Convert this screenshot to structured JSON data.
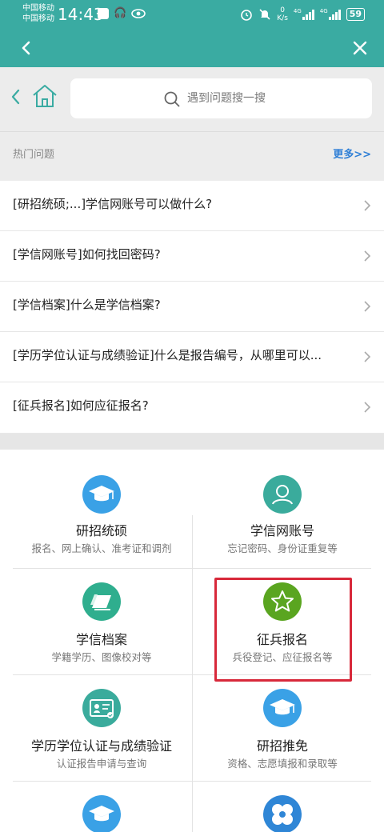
{
  "status_bar": {
    "carrier_1": "中国移动",
    "carrier_2": "中国移动",
    "time": "14:43",
    "net_speed_value": "0",
    "net_speed_unit": "K/s",
    "signal_1_tag": "4G",
    "signal_2_tag": "4G",
    "battery": "59"
  },
  "title_bar": {
    "back_icon": "chevron-left-icon",
    "close_icon": "close-icon"
  },
  "search": {
    "placeholder": "遇到问题搜一搜"
  },
  "hot": {
    "title": "热门问题",
    "more": "更多>>"
  },
  "questions": [
    "[研招统硕;...]学信网账号可以做什么?",
    "[学信网账号]如何找回密码?",
    "[学信档案]什么是学信档案?",
    "[学历学位认证与成绩验证]什么是报告编号，从哪里可以...",
    "[征兵报名]如何应征报名?"
  ],
  "services": [
    {
      "title": "研招统硕",
      "subtitle": "报名、网上确认、准考证和调剂",
      "icon": "graduation-cap-icon",
      "color": "#3aa1e6"
    },
    {
      "title": "学信网账号",
      "subtitle": "忘记密码、身份证重复等",
      "icon": "user-icon",
      "color": "#3aab9c"
    },
    {
      "title": "学信档案",
      "subtitle": "学籍学历、图像校对等",
      "icon": "documents-icon",
      "color": "#2fae8e"
    },
    {
      "title": "征兵报名",
      "subtitle": "兵役登记、应征报名等",
      "icon": "star-icon",
      "color": "#5aa520"
    },
    {
      "title": "学历学位认证与成绩验证",
      "subtitle": "认证报告申请与查询",
      "icon": "id-card-icon",
      "color": "#3aab9c"
    },
    {
      "title": "研招推免",
      "subtitle": "资格、志愿填报和录取等",
      "icon": "graduation-cap-icon",
      "color": "#3aa1e6"
    },
    {
      "title": "",
      "subtitle": "",
      "icon": "graduation-cap-icon",
      "color": "#3aa1e6"
    },
    {
      "title": "",
      "subtitle": "",
      "icon": "flower-icon",
      "color": "#2f86d6"
    }
  ]
}
